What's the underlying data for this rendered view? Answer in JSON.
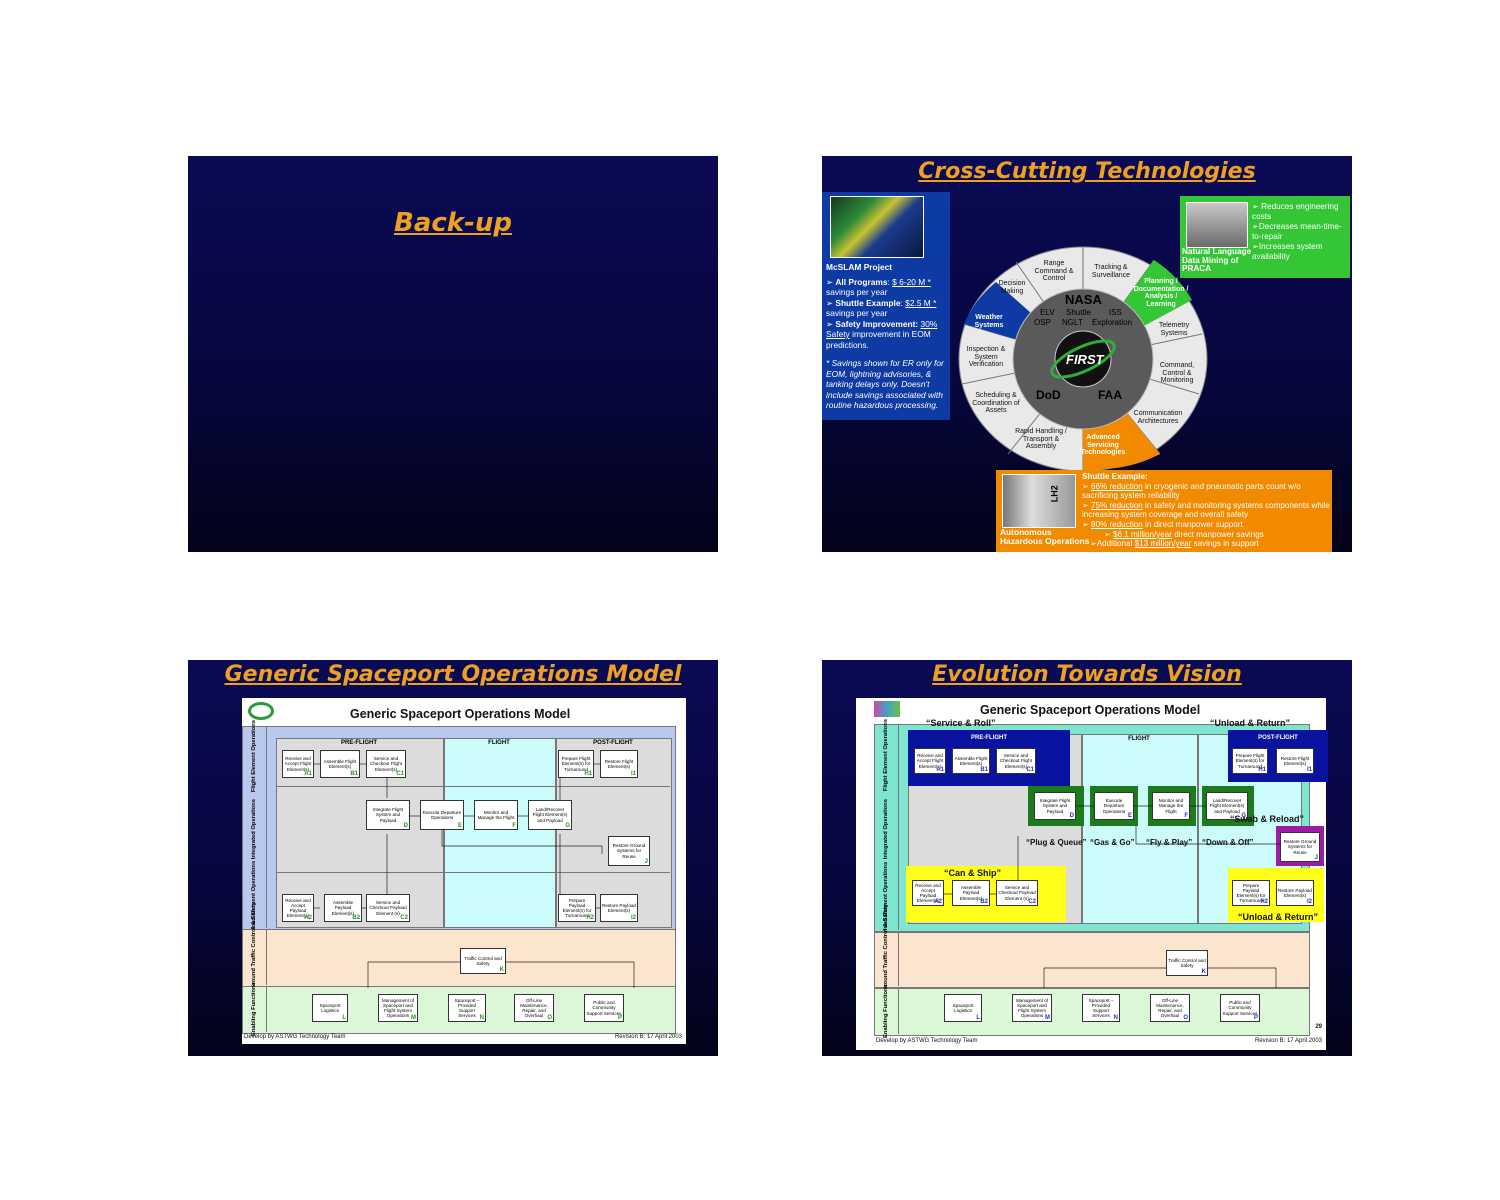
{
  "slide1": {
    "title": "Back-up"
  },
  "slide2": {
    "title": "Cross-Cutting Technologies",
    "weather": {
      "project": "McSLAM Project",
      "all_programs": "All Programs",
      "all_programs_value": "$ 6-20 M *",
      "all_programs_suffix": "savings per year",
      "shuttle": "Shuttle Example",
      "shuttle_value": "$2.5 M *",
      "shuttle_suffix": "savings per year",
      "safety": "Safety Improvement:",
      "safety_value": "30% Safety",
      "safety_suffix": "improvement in EOM predictions.",
      "note": "* Savings shown for ER only for EOM, lightning advisories, & tanking delays only. Doesn't include savings associated with routine hazardous processing.",
      "segment": "Weather Systems"
    },
    "green": {
      "bullet1": "➢ Reduces engineering costs",
      "bullet2": "➢Decreases mean-time-to-repair",
      "bullet3": "➢Increases system availability",
      "caption": "Natural Language Data Mining of PRACA",
      "segment": "Planning / Documentation / Analysis / Learning"
    },
    "orange": {
      "segment": "Advanced Servicing Technologies",
      "heading": "Shuttle Example:",
      "b1_u": "66% reduction",
      "b1": " in cryogenic and pneumatic parts count w/o sacrificing system reliability",
      "b2_u": "75% reduction",
      "b2": " in safety and monitoring systems components while increasing system coverage and overall safety",
      "b3_u": "80% reduction",
      "b3": " in direct manpower support",
      "b4_u": "$6.1 million/year",
      "b4": " direct manpower savings",
      "b5_pre": "➢Additional ",
      "b5_u": "$13 million/year",
      "b5": " savings in support",
      "caption": "Autonomous Hazardous Operations",
      "device_label": "LH2"
    },
    "segments": {
      "range": "Range Command & Control",
      "tracking": "Tracking & Surveillance",
      "decision": "Decision Making",
      "telemetry": "Telemetry Systems",
      "inspection": "Inspection & System Verification",
      "command": "Command, Control & Monitoring",
      "scheduling": "Scheduling & Coordination of Assets",
      "communication": "Communication Architectures",
      "rapid": "Rapid Handling / Transport & Assembly"
    },
    "center": {
      "nasa": "NASA",
      "elv": "ELV",
      "shuttle": "Shuttle",
      "iss": "ISS",
      "osp": "OSP",
      "nglt": "NGLT",
      "exploration": "Exploration",
      "first": "FIRST",
      "dod": "DoD",
      "faa": "FAA"
    }
  },
  "model": {
    "title": "Generic Spaceport Operations Model",
    "phases": {
      "pre": "PRE-FLIGHT",
      "flight": "FLIGHT",
      "post": "POST-FLIGHT"
    },
    "lanes": {
      "flight_elem": "Flight Element Operations",
      "integrated": "Integrated Operations",
      "payload": "Payload Element Operations",
      "traffic": "Flight & Ground Traffic Control & Safety",
      "enabling": "Enabling Functions"
    },
    "boxes": {
      "A1": "Receive and Accept Flight Element(s)",
      "B1": "Assemble Flight Element(s)",
      "C1": "Service and Checkout Flight Element(s)",
      "H1": "Prepare Flight Element(s) for Turnaround",
      "I1": "Restore Flight Element(s)",
      "D": "Integrate Flight System and Payload",
      "E": "Execute Departure Operations",
      "F": "Monitor and Manage the Flight",
      "G": "Land/Recover Flight Element(s) and Payload",
      "J": "Restore Ground Systems for Reuse",
      "A2": "Receive and Accept Payload Element(s)",
      "B2": "Assemble Payload Element(s)",
      "C2": "Service and Checkout Payload Element (s)",
      "H2": "Prepare Payload Element(s) for Turnaround",
      "I2": "Restore Payload Element(s)",
      "K": "Traffic Control and Safety",
      "L": "Spaceport Logistics",
      "M": "Management of Spaceport and Flight System Operations",
      "N": "Spaceport – Provided Support Services",
      "O": "Off-Line Maintenance, Repair, and Overhaul",
      "P": "Public and Community Support Services"
    },
    "tags": {
      "A1": "A1",
      "B1": "B1",
      "C1": "C1",
      "H1": "H1",
      "I1": "I1",
      "D": "D",
      "E": "E",
      "F": "F",
      "G": "G",
      "J": "J",
      "A2": "A2",
      "B2": "B2",
      "C2": "C2",
      "H2": "H2",
      "I2": "I2",
      "K": "K",
      "L": "L",
      "M": "M",
      "N": "N",
      "O": "O",
      "P": "P"
    },
    "footer_left": "Develop by ASTWG Technology Team",
    "footer_right": "Revision B:  17 April 2003"
  },
  "slide3": {
    "title": "Generic Spaceport Operations Model"
  },
  "slide4": {
    "title": "Evolution Towards Vision",
    "quotes": {
      "service_roll": "“Service & Roll”",
      "unload_return_top": "“Unload & Return”",
      "plug_queue": "“Plug & Queue”",
      "gas_go": "“Gas & Go”",
      "fly_play": "“Fly & Play”",
      "down_off": "“Down & Off”",
      "swab_reload": "“Swab & Reload”",
      "can_ship": "“Can & Ship”",
      "unload_return_bottom": "“Unload & Return”"
    },
    "page_number": "29"
  }
}
